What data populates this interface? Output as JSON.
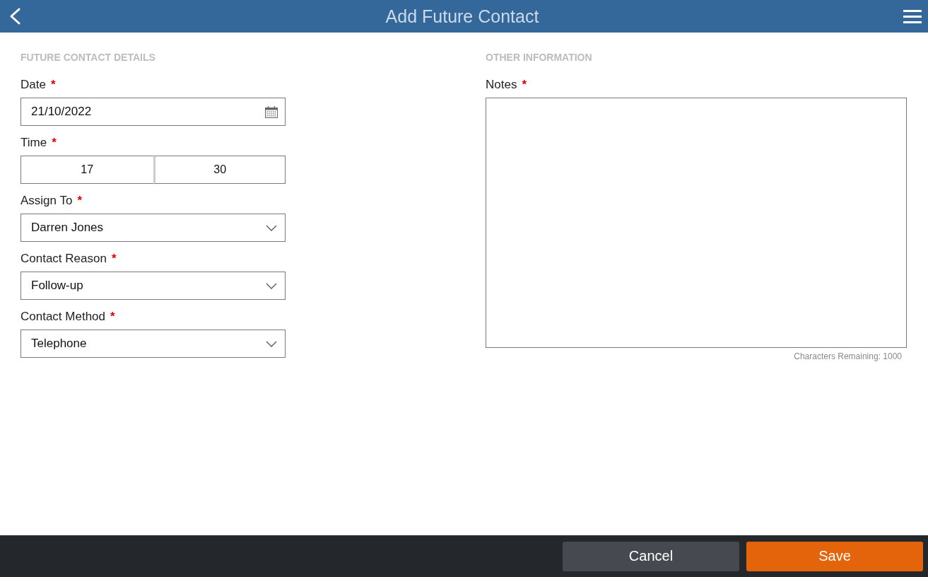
{
  "header": {
    "title": "Add Future Contact"
  },
  "sections": [
    {
      "heading": "FUTURE CONTACT DETAILS",
      "fields": [
        {
          "kind": "date",
          "label": "Date",
          "required_mark": "*",
          "value": "21/10/2022"
        },
        {
          "kind": "time",
          "label": "Time",
          "required_mark": "*",
          "hours": "17",
          "minutes": "30"
        },
        {
          "kind": "select",
          "label": "Assign To",
          "required_mark": "*",
          "value": "Darren Jones"
        },
        {
          "kind": "select",
          "label": "Contact Reason",
          "required_mark": "*",
          "value": "Follow-up"
        },
        {
          "kind": "select",
          "label": "Contact Method",
          "required_mark": "*",
          "value": "Telephone"
        }
      ]
    },
    {
      "heading": "OTHER INFORMATION",
      "fields": [
        {
          "kind": "textarea",
          "label": "Notes",
          "required_mark": "*",
          "counter": "Characters Remaining: 1000"
        }
      ]
    }
  ],
  "footer": {
    "buttons": [
      {
        "label": "Cancel",
        "kind": "secondary"
      },
      {
        "label": "Save",
        "kind": "primary"
      }
    ]
  }
}
